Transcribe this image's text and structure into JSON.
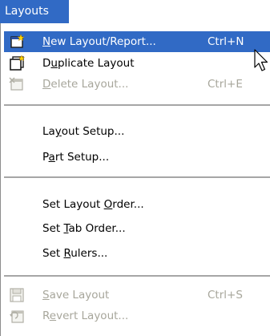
{
  "menu": {
    "title": "Layouts",
    "items": [
      {
        "label": "New Layout/Report...",
        "mnemonic": "N",
        "shortcut": "Ctrl+N",
        "icon": "new-layout-icon",
        "enabled": true,
        "highlighted": true
      },
      {
        "label": "Duplicate Layout",
        "mnemonic": "u",
        "shortcut": "",
        "icon": "duplicate-layout-icon",
        "enabled": true
      },
      {
        "label": "Delete Layout...",
        "mnemonic": "D",
        "shortcut": "Ctrl+E",
        "icon": "delete-layout-icon",
        "enabled": false
      },
      {
        "label": "Layout Setup...",
        "mnemonic": "y",
        "enabled": true
      },
      {
        "label": "Part Setup...",
        "mnemonic": "a",
        "enabled": true
      },
      {
        "label": "Set Layout Order...",
        "mnemonic": "O",
        "enabled": true
      },
      {
        "label": "Set Tab Order...",
        "mnemonic": "T",
        "enabled": true
      },
      {
        "label": "Set Rulers...",
        "mnemonic": "R",
        "enabled": true
      },
      {
        "label": "Save Layout",
        "mnemonic": "S",
        "shortcut": "Ctrl+S",
        "icon": "save-layout-icon",
        "enabled": false
      },
      {
        "label": "Revert Layout...",
        "mnemonic": "e",
        "icon": "revert-layout-icon",
        "enabled": false
      }
    ]
  },
  "colors": {
    "highlight": "#316ac5",
    "disabled_text": "#a7a69b"
  }
}
